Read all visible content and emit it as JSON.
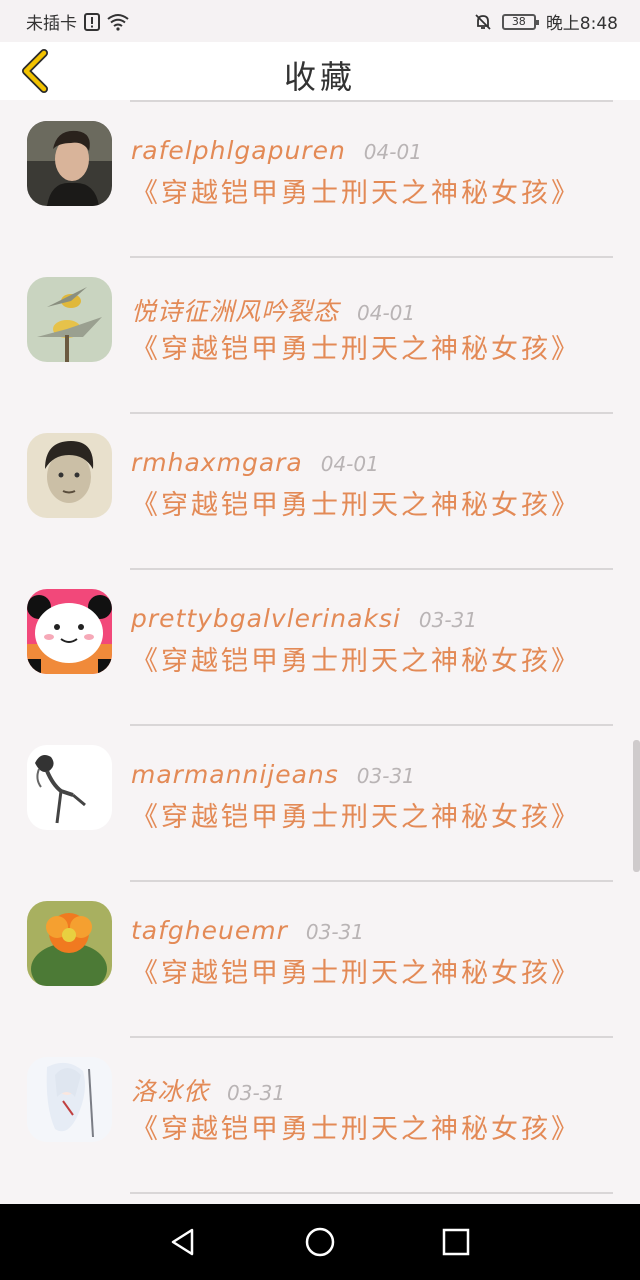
{
  "status_bar": {
    "carrier": "未插卡",
    "battery": "38",
    "time": "晚上8:48"
  },
  "header": {
    "title": "收藏"
  },
  "favorites": [
    {
      "name": "rafelphlgapuren",
      "date": "04-01",
      "title": "《穿越铠甲勇士刑天之神秘女孩》"
    },
    {
      "name": "悦诗征洲风吟裂态",
      "date": "04-01",
      "title": "《穿越铠甲勇士刑天之神秘女孩》"
    },
    {
      "name": "rmhaxmgara",
      "date": "04-01",
      "title": "《穿越铠甲勇士刑天之神秘女孩》"
    },
    {
      "name": "prettybgalvlerinaksi",
      "date": "03-31",
      "title": "《穿越铠甲勇士刑天之神秘女孩》"
    },
    {
      "name": "marmannijeans",
      "date": "03-31",
      "title": "《穿越铠甲勇士刑天之神秘女孩》"
    },
    {
      "name": "tafgheuemr",
      "date": "03-31",
      "title": "《穿越铠甲勇士刑天之神秘女孩》"
    },
    {
      "name": "洛冰依",
      "date": "03-31",
      "title": "《穿越铠甲勇士刑天之神秘女孩》"
    }
  ],
  "colors": {
    "accent": "#e38a56",
    "date": "#b9b4b5",
    "back_icon": "#f2c200"
  },
  "icons": {
    "back": "chevron-left-icon",
    "nav_back": "triangle-back-icon",
    "nav_home": "circle-home-icon",
    "nav_recent": "square-recent-icon"
  }
}
